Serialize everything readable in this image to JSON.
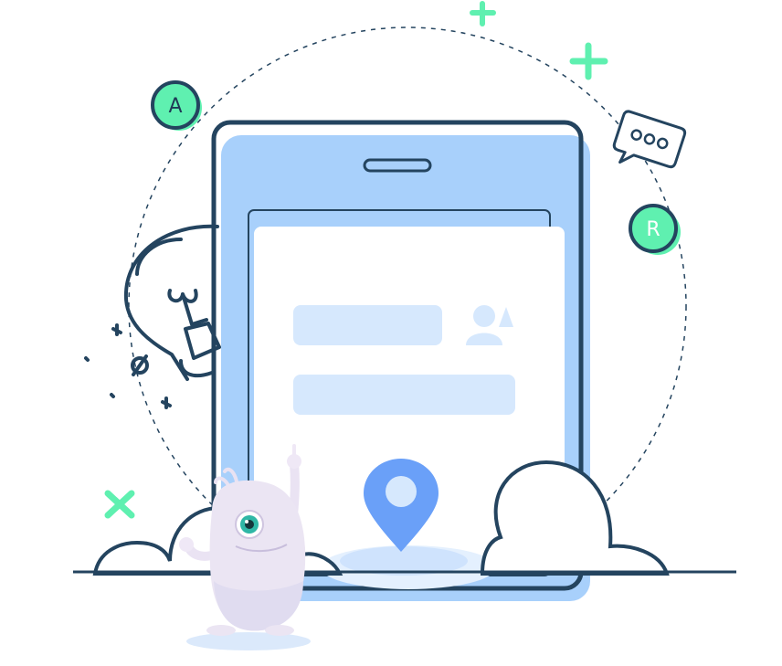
{
  "badges": {
    "a_label": "A",
    "r_label": "R"
  },
  "colors": {
    "navy": "#24445f",
    "phone_blue": "#a8d0fb",
    "screen_white": "#ffffff",
    "field_blue": "#d6e8fd",
    "mint": "#5ff0b0",
    "pin_blue": "#6aa0f8"
  },
  "icons": [
    "plus-icon",
    "cross-icon",
    "chat-bubble-icon",
    "lightbulb-icon",
    "user-icon",
    "location-pin-icon"
  ]
}
